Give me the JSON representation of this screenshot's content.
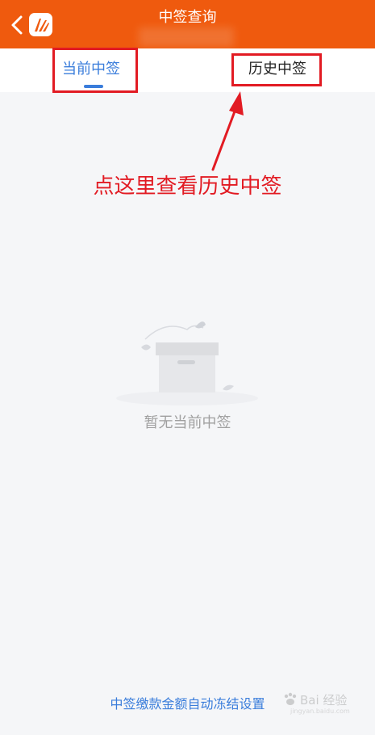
{
  "header": {
    "title": "中签查询",
    "icons": {
      "back": "chevron-left-icon",
      "logo": "app-logo"
    },
    "background": "#ef5a0e"
  },
  "tabs": [
    {
      "label": "当前中签",
      "active": true
    },
    {
      "label": "历史中签",
      "active": false
    }
  ],
  "annotation": {
    "text": "点这里查看历史中签",
    "color": "#e21b23"
  },
  "empty_state": {
    "text": "暂无当前中签",
    "icon": "empty-box-icon"
  },
  "footer": {
    "link_label": "中签缴款金额自动冻结设置"
  },
  "watermark": {
    "brand": "Bai  经验",
    "sub": "jingyan.baidu.com"
  },
  "colors": {
    "accent": "#3a7ddb",
    "highlight": "#e21b23",
    "page_bg": "#f5f6f8"
  }
}
